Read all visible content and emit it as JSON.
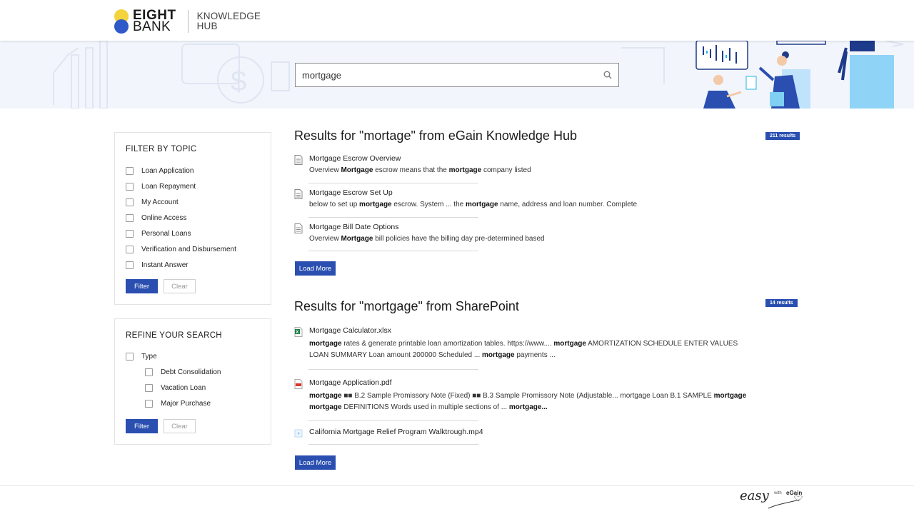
{
  "header": {
    "brand_line1": "EIGHT",
    "brand_line2": "BANK",
    "hub_line1": "KNOWLEDGE",
    "hub_line2": "HUB"
  },
  "search": {
    "value": "mortgage",
    "placeholder": ""
  },
  "filter_topic": {
    "title": "FILTER BY TOPIC",
    "items": [
      {
        "label": "Loan Application"
      },
      {
        "label": "Loan Repayment"
      },
      {
        "label": "My Account"
      },
      {
        "label": "Online Access"
      },
      {
        "label": "Personal Loans"
      },
      {
        "label": "Verification and Disbursement"
      },
      {
        "label": "Instant Answer"
      }
    ],
    "filter_label": "Filter",
    "clear_label": "Clear"
  },
  "refine": {
    "title": "REFINE YOUR SEARCH",
    "parent": "Type",
    "items": [
      {
        "label": "Debt Consolidation"
      },
      {
        "label": "Vacation Loan"
      },
      {
        "label": "Major Purchase"
      }
    ],
    "filter_label": "Filter",
    "clear_label": "Clear"
  },
  "egain": {
    "title": "Results for \"mortage\" from eGain Knowledge Hub",
    "count": "211 results",
    "load_more": "Load More",
    "results": [
      {
        "icon": "document-icon",
        "title": "Mortgage Escrow Overview",
        "snippet": [
          [
            "Overview ",
            false
          ],
          [
            "Mortgage",
            true
          ],
          [
            " escrow means that the ",
            false
          ],
          [
            "mortgage",
            true
          ],
          [
            " company listed",
            false
          ]
        ]
      },
      {
        "icon": "document-icon",
        "title": "Mortgage Escrow Set Up",
        "snippet": [
          [
            "below to set up ",
            false
          ],
          [
            "mortgage",
            true
          ],
          [
            " escrow. System ... the ",
            false
          ],
          [
            "mortgage",
            true
          ],
          [
            " name, address and loan number. Complete",
            false
          ]
        ]
      },
      {
        "icon": "document-icon",
        "title": "Mortgage Bill Date Options",
        "snippet": [
          [
            "Overview ",
            false
          ],
          [
            "Mortgage",
            true
          ],
          [
            " bill policies have the billing day pre-determined based",
            false
          ]
        ]
      }
    ]
  },
  "sharepoint": {
    "title": "Results for \"mortgage\" from SharePoint",
    "count": "14 results",
    "load_more": "Load More",
    "results": [
      {
        "icon": "excel-file-icon",
        "title": "Mortgage Calculator.xlsx",
        "snippet": [
          [
            "mortgage",
            true
          ],
          [
            " rates & generate printable loan amortization tables. https://www.... ",
            false
          ],
          [
            "mortgage",
            true
          ],
          [
            " AMORTIZATION SCHEDULE ENTER VALUES LOAN SUMMARY Loan amount 200000 Scheduled ... ",
            false
          ],
          [
            "mortgage",
            true
          ],
          [
            " payments ...",
            false
          ]
        ]
      },
      {
        "icon": "pdf-file-icon",
        "title": "Mortgage Application.pdf",
        "snippet": [
          [
            "mortgage",
            true
          ],
          [
            " ■■ B.2 Sample Promissory Note (Fixed) ■■ B.3 Sample Promissory Note (Adjustable... mortgage Loan B.1 SAMPLE ",
            false
          ],
          [
            "mortgage mortgage",
            true
          ],
          [
            " DEFINITIONS Words used in multiple sections of ... ",
            false
          ],
          [
            "mortgage...",
            true
          ]
        ]
      },
      {
        "icon": "video-file-icon",
        "title": "California Mortgage Relief Program Walktrough.mp4",
        "snippet": []
      }
    ]
  },
  "footer": {
    "easy": "easy",
    "with": "with",
    "brand": "eGain"
  },
  "colors": {
    "primary": "#2a4fb0",
    "logo_yellow": "#f4d33c",
    "logo_blue": "#2f58c9",
    "hero_bg": "#f2f5fb"
  }
}
